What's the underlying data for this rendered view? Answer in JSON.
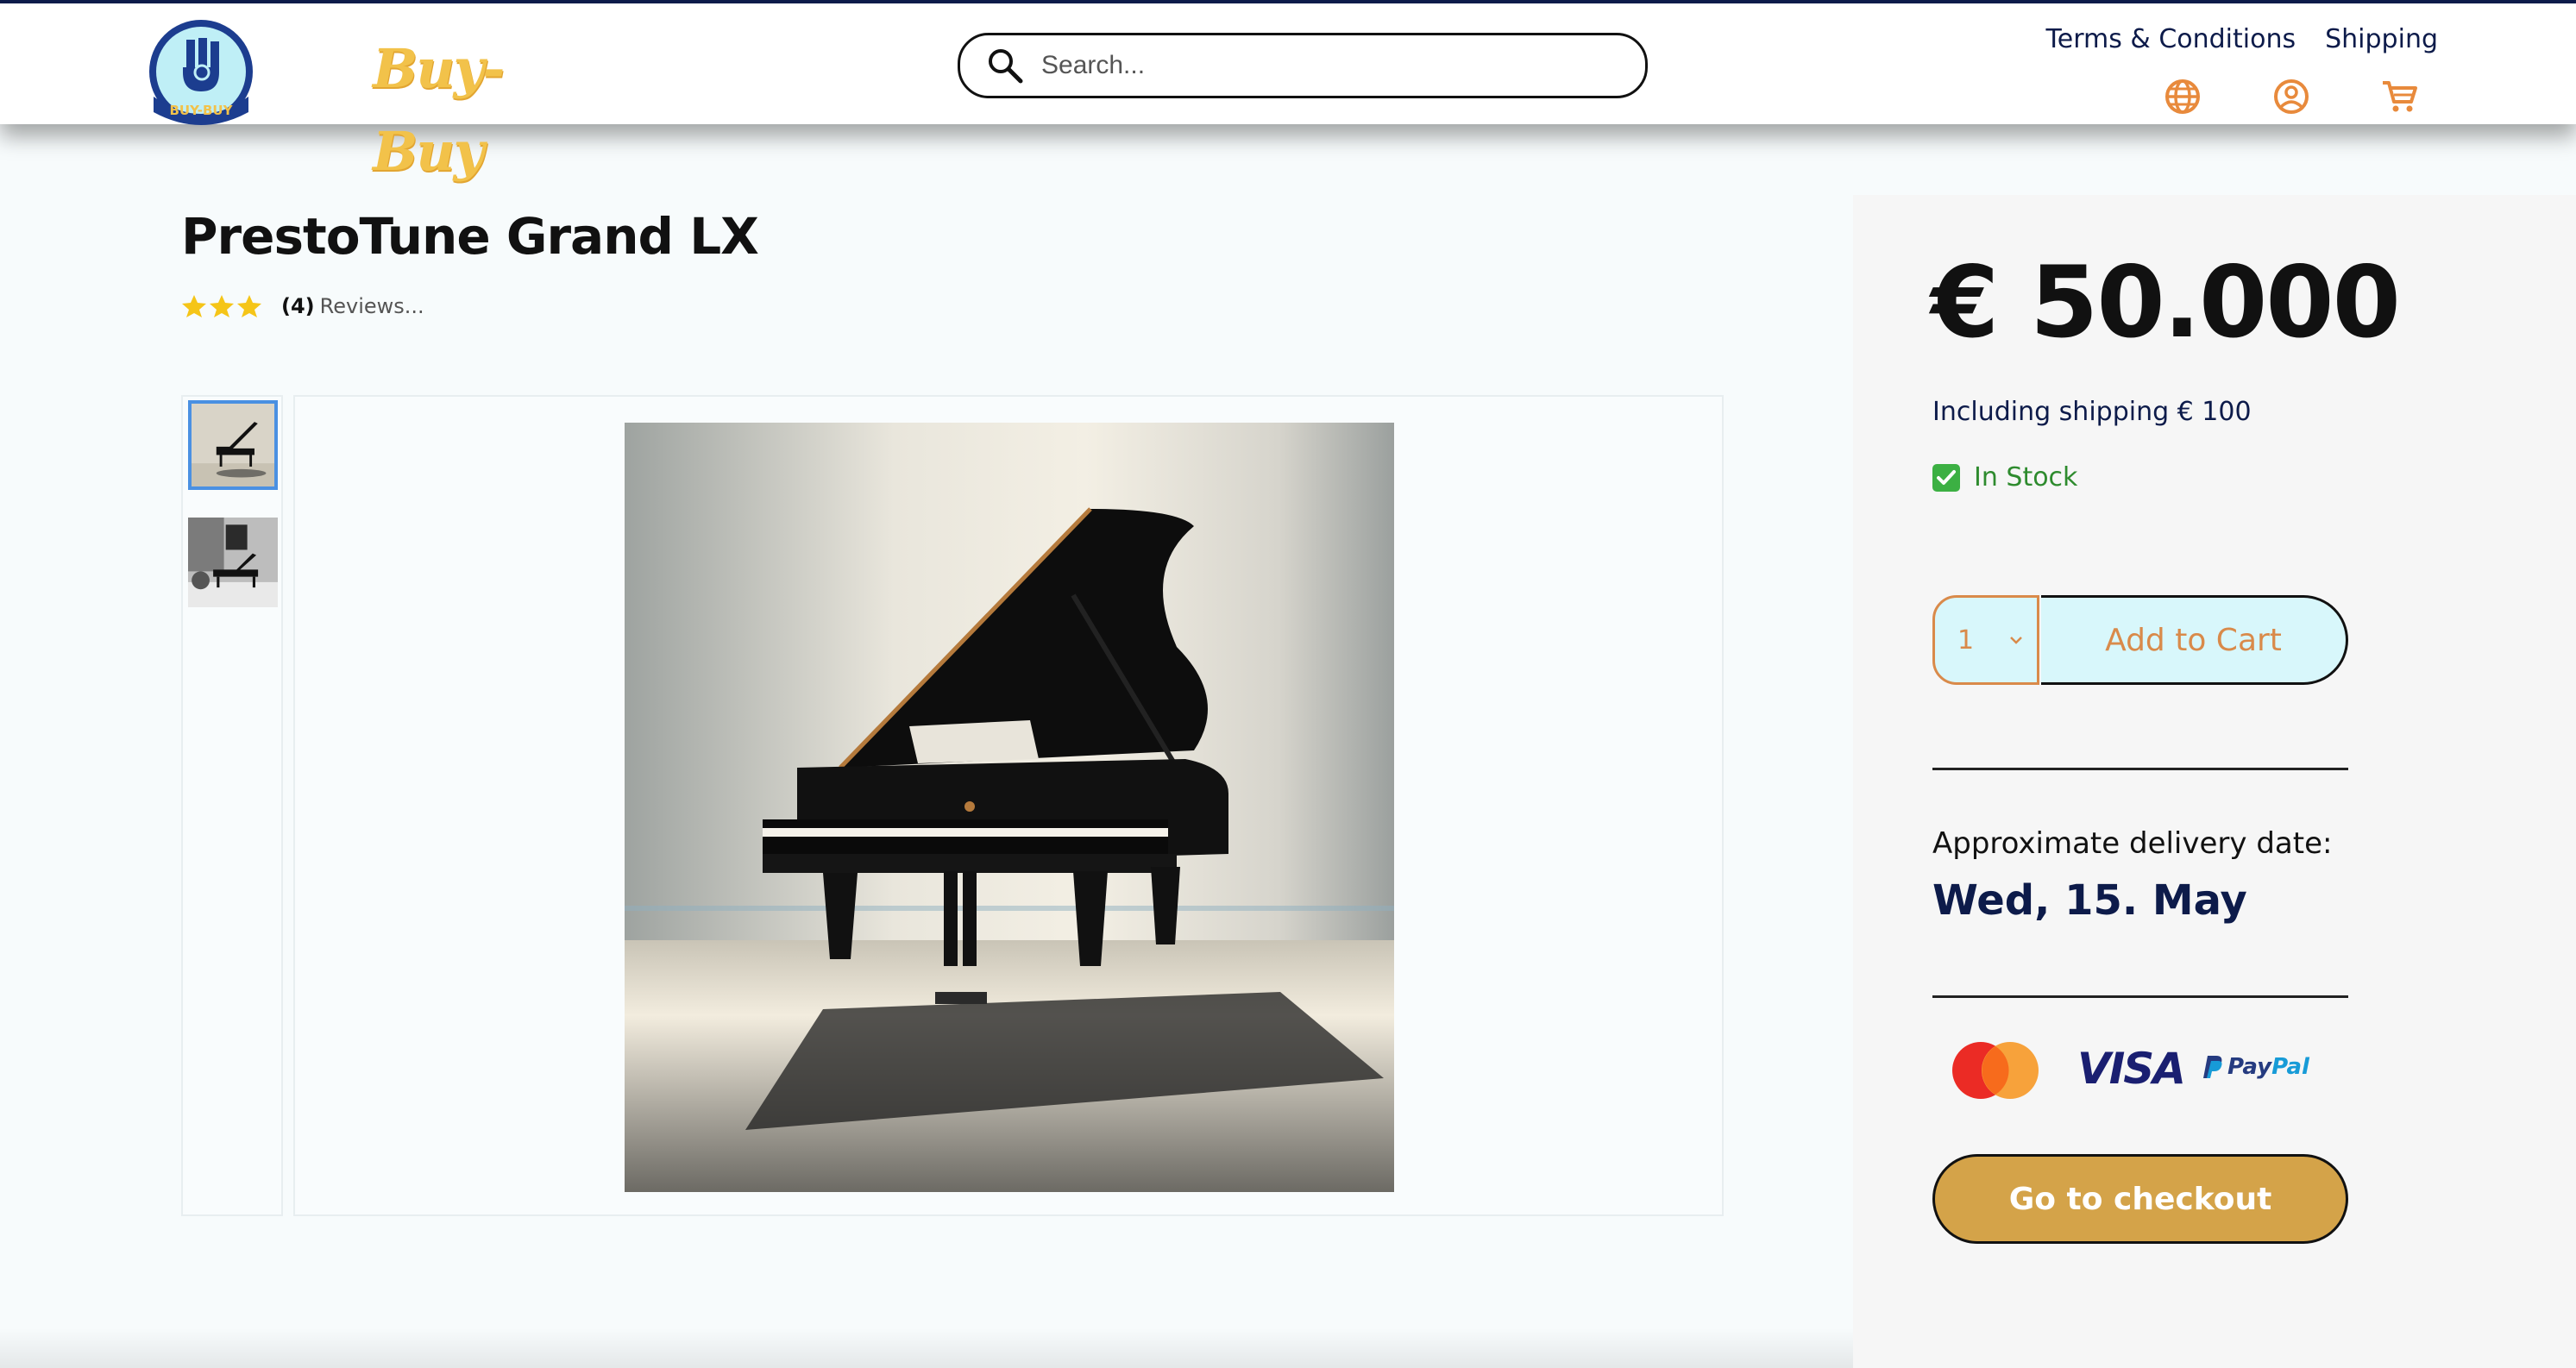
{
  "header": {
    "brand_word": "Buy-Buy",
    "logo_text": "BUY-BUY",
    "search_placeholder": "Search...",
    "links": [
      "Terms & Conditions",
      "Shipping"
    ],
    "icons": [
      "globe-icon",
      "user-icon",
      "cart-icon"
    ],
    "accent": "#e88a3c"
  },
  "product": {
    "title": "PrestoTune Grand LX",
    "stars": 3,
    "review_count": "(4)",
    "review_label": "Reviews...",
    "thumbnails": [
      "grand-piano-studio",
      "grand-piano-room"
    ],
    "selected_thumbnail": 0
  },
  "buybox": {
    "price": "€ 50.000",
    "shipping": "Including shipping € 100",
    "stock": "In Stock",
    "quantity": "1",
    "add_to_cart": "Add to Cart",
    "delivery_label": "Approximate delivery date:",
    "delivery_date": "Wed, 15. May",
    "payments": {
      "mastercard": "mastercard-icon",
      "visa": "VISA",
      "paypal_a": "Pay",
      "paypal_b": "Pal"
    },
    "checkout": "Go to checkout"
  },
  "colors": {
    "navy": "#0d1b4a",
    "orange": "#d98a4a",
    "cyan": "#d8f7fb",
    "gold": "#d4a349",
    "green": "#2e8b2e"
  }
}
